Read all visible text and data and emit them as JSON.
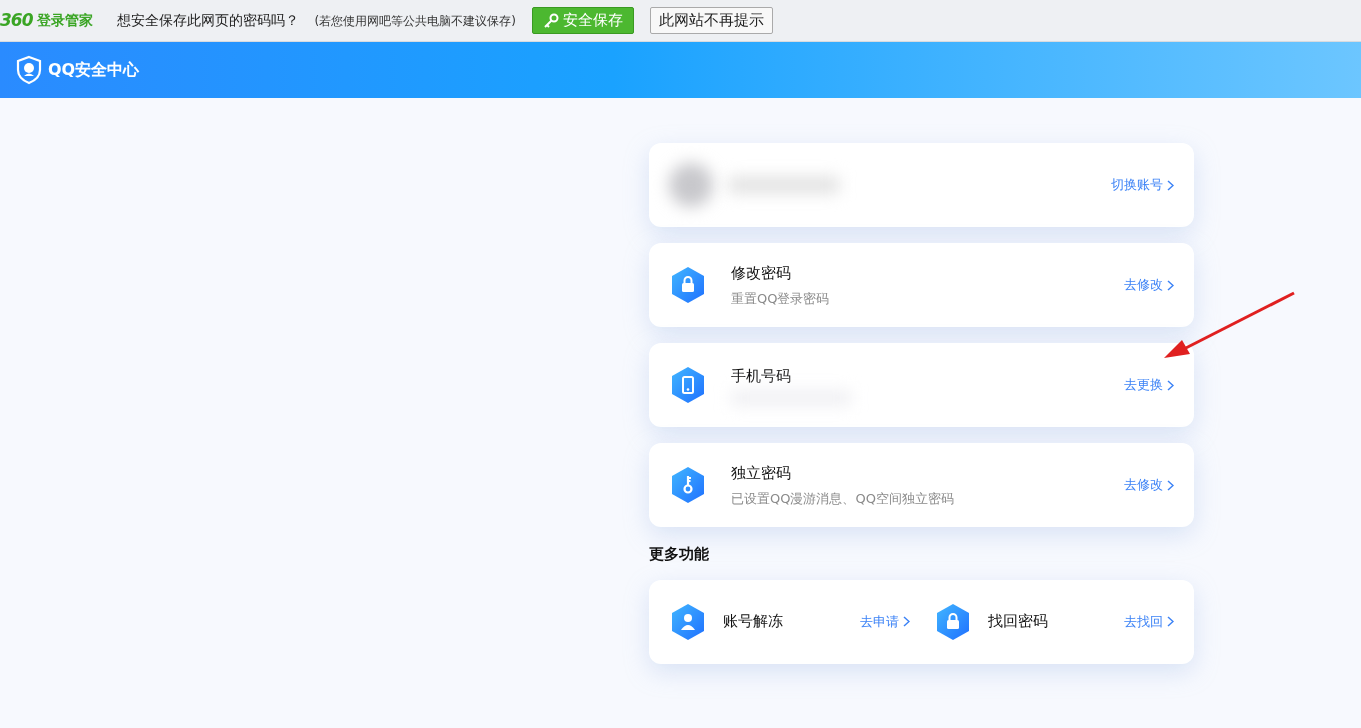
{
  "password_bar": {
    "logo": "360",
    "logo_text": "登录管家",
    "question": "想安全保存此网页的密码吗？",
    "note": "(若您使用网吧等公共电脑不建议保存)",
    "save_button": "安全保存",
    "dismiss_button": "此网站不再提示"
  },
  "header": {
    "title": "QQ安全中心"
  },
  "account": {
    "action": "切换账号"
  },
  "settings": [
    {
      "kind": "lock",
      "title": "修改密码",
      "subtitle": "重置QQ登录密码",
      "action": "去修改"
    },
    {
      "kind": "phone",
      "title": "手机号码",
      "action": "去更换"
    },
    {
      "kind": "key",
      "title": "独立密码",
      "subtitle": "已设置QQ漫游消息、QQ空间独立密码",
      "action": "去修改"
    }
  ],
  "more": {
    "heading": "更多功能",
    "items": [
      {
        "kind": "person",
        "title": "账号解冻",
        "action": "去申请"
      },
      {
        "kind": "lock",
        "title": "找回密码",
        "action": "去找回"
      }
    ]
  }
}
